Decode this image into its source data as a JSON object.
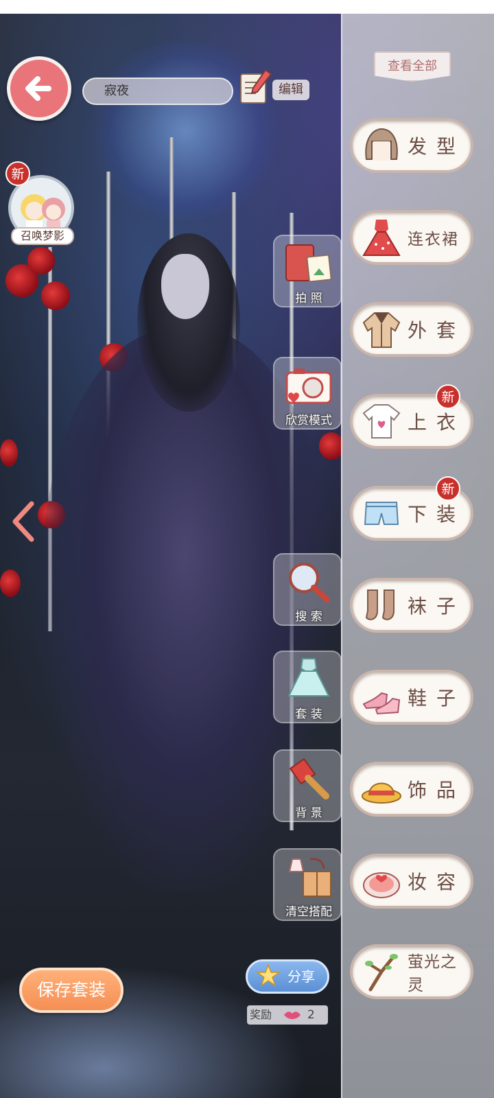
{
  "header": {
    "outfit_name": "寂夜",
    "edit_label": "编辑",
    "view_all_label": "查看全部"
  },
  "summon": {
    "badge": "新",
    "label": "召唤梦影"
  },
  "tools": [
    {
      "label": "拍 照",
      "icon": "album-icon"
    },
    {
      "label": "欣赏模式",
      "icon": "camera-icon"
    },
    {
      "label": "搜 索",
      "icon": "magnifier-icon"
    },
    {
      "label": "套 装",
      "icon": "suit-icon"
    },
    {
      "label": "背 景",
      "icon": "paintbrush-icon"
    },
    {
      "label": "清空搭配",
      "icon": "clear-outfit-icon"
    }
  ],
  "categories": [
    {
      "label": "发型",
      "icon": "hair-icon",
      "new": false
    },
    {
      "label": "连衣裙",
      "icon": "dress-icon",
      "new": false
    },
    {
      "label": "外套",
      "icon": "coat-icon",
      "new": false
    },
    {
      "label": "上衣",
      "icon": "tshirt-icon",
      "new": true
    },
    {
      "label": "下装",
      "icon": "shorts-icon",
      "new": true
    },
    {
      "label": "袜子",
      "icon": "socks-icon",
      "new": false
    },
    {
      "label": "鞋子",
      "icon": "shoes-icon",
      "new": false
    },
    {
      "label": "饰品",
      "icon": "hat-icon",
      "new": false
    },
    {
      "label": "妆容",
      "icon": "compact-icon",
      "new": false
    },
    {
      "label": "萤光之灵",
      "icon": "branch-icon",
      "new": false
    }
  ],
  "new_badge_text": "新",
  "bottom": {
    "save_label": "保存套装",
    "share_label": "分享",
    "reward_label": "奖励",
    "reward_count": "2"
  },
  "colors": {
    "accent": "#e9757a",
    "category_text": "#6b4e45",
    "badge": "#c9302c",
    "save_button": "#f58f54",
    "share_button": "#5b8fd4"
  }
}
